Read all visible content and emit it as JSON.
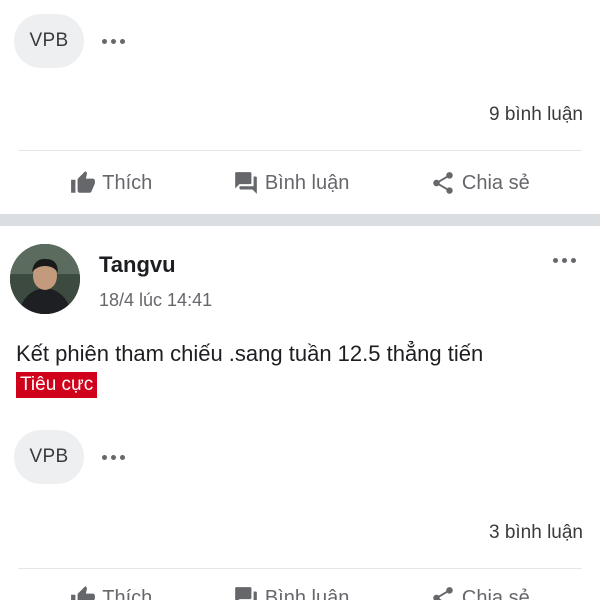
{
  "post1": {
    "ticker_chip": "VPB",
    "comment_count": "9 bình luận",
    "actions": {
      "like": "Thích",
      "comment": "Bình luận",
      "share": "Chia sẻ"
    }
  },
  "post2": {
    "author": "Tangvu",
    "timestamp": "18/4 lúc 14:41",
    "text": "Kết phiên tham chiếu .sang tuần 12.5 thẳng tiến",
    "sentiment_tag": "Tiêu cực",
    "ticker_chip": "VPB",
    "comment_count": "3 bình luận",
    "actions": {
      "like": "Thích",
      "comment": "Bình luận",
      "share": "Chia sẻ"
    }
  },
  "colors": {
    "sentiment_negative": "#d0021b",
    "chip_bg": "#eeeff1",
    "action_text": "#65676b"
  },
  "icons": [
    "more-dots-icon",
    "thumbs-up-icon",
    "comment-icon",
    "share-icon"
  ]
}
